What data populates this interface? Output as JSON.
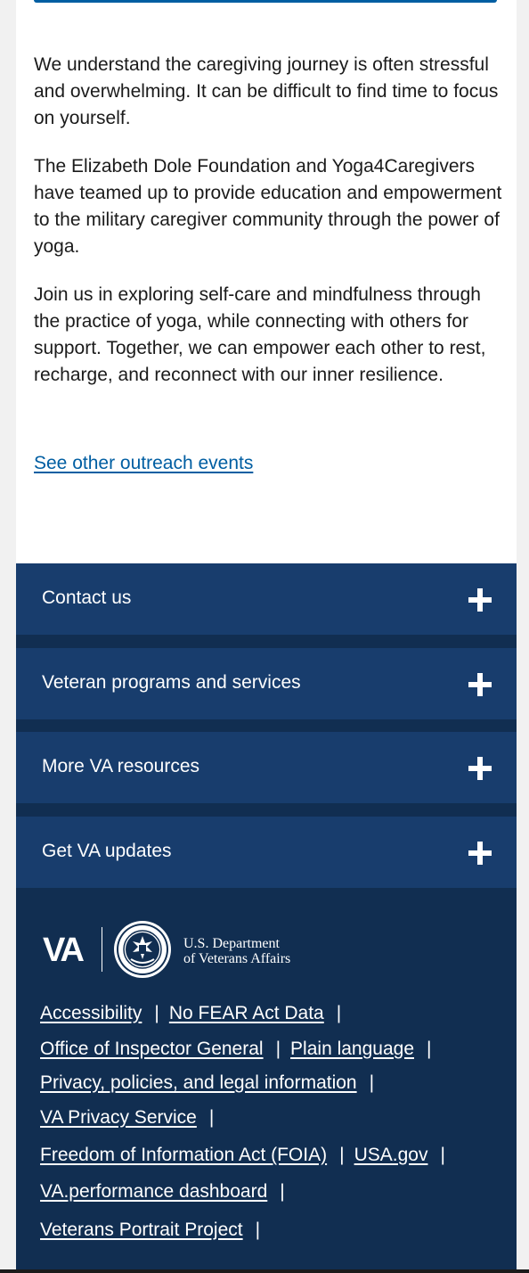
{
  "content": {
    "paragraphs": [
      "We understand the caregiving journey is often stressful and overwhelming. It can be difficult to find time to focus on yourself.",
      "The Elizabeth Dole Foundation and Yoga4Caregivers have teamed up to provide education and empowerment to the military caregiver community through the power of yoga.",
      "Join us in exploring self-care and mindfulness through the practice of yoga, while connecting with others for support. Together, we can empower each other to rest, recharge, and reconnect with our inner resilience."
    ],
    "outreach_link": "See other outreach events"
  },
  "footer": {
    "accordions": [
      {
        "label": "Contact us",
        "icon": "plus-icon"
      },
      {
        "label": "Veteran programs and services",
        "icon": "plus-icon"
      },
      {
        "label": "More VA resources",
        "icon": "plus-icon"
      },
      {
        "label": "Get VA updates",
        "icon": "plus-icon"
      }
    ],
    "logo": {
      "mark": "VA",
      "dept_line1": "U.S. Department",
      "dept_line2": "of Veterans Affairs"
    },
    "links": [
      "Accessibility",
      "No FEAR Act Data",
      "Office of Inspector General",
      "Plain language",
      "Privacy, policies, and legal information",
      "VA Privacy Service",
      "Freedom of Information Act (FOIA)",
      "USA.gov",
      "VA.performance dashboard",
      "Veterans Portrait Project"
    ],
    "separator": "|"
  },
  "colors": {
    "footer_bg": "#112e51",
    "accordion_bg": "#183d6d",
    "link_blue": "#005ea2"
  }
}
